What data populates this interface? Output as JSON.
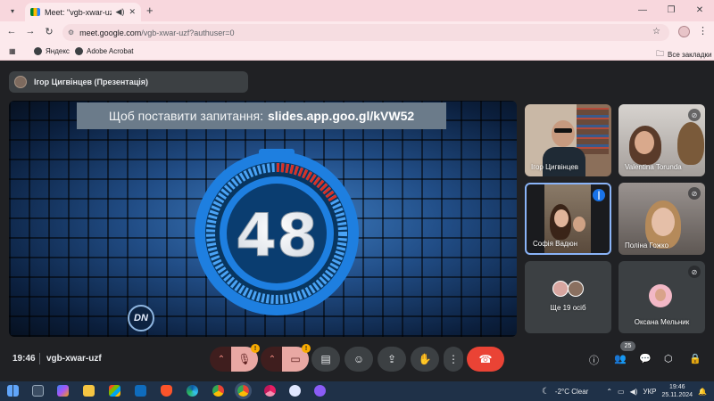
{
  "browser": {
    "tab_title": "Meet: \"vgb-xwar-uzf\"",
    "tab_close": "✕",
    "new_tab": "+",
    "url_host": "meet.google.com",
    "url_path": "/vgb-xwar-uzf?authuser=0",
    "bookmarks": [
      "Яндекс",
      "Adobe Acrobat"
    ],
    "all_bookmarks": "Все закладки"
  },
  "meet": {
    "presenter_label": "Ігор Цигвінцев (Презентація)",
    "slide": {
      "banner_text": "Щоб поставити запитання:",
      "banner_url": "slides.app.goo.gl/kVW52",
      "timer_value": "48",
      "logo_text": "DN"
    },
    "participants": [
      {
        "name": "Ігор Цигвінцев",
        "muted": false
      },
      {
        "name": "Valentina Torunda",
        "muted": true
      },
      {
        "name": "Софія Вадюн",
        "muted": false,
        "speaking": true
      },
      {
        "name": "Поліна Гожко",
        "muted": true
      },
      {
        "name": "Ще 19 осіб",
        "muted": false
      },
      {
        "name": "Оксана Мельник",
        "muted": true
      }
    ],
    "bottom": {
      "time": "19:46",
      "meeting_code": "vgb-xwar-uzf",
      "people_count": "25"
    }
  },
  "taskbar": {
    "weather": "-2°C  Clear",
    "language": "УКР",
    "time": "19:46",
    "date": "25.11.2024"
  },
  "colors": {
    "hangup": "#ea4335",
    "speaking": "#1a73e8",
    "timer_ring": "#1e7fe0",
    "timer_progress": "#d93025",
    "warning": "#f9ab00"
  }
}
